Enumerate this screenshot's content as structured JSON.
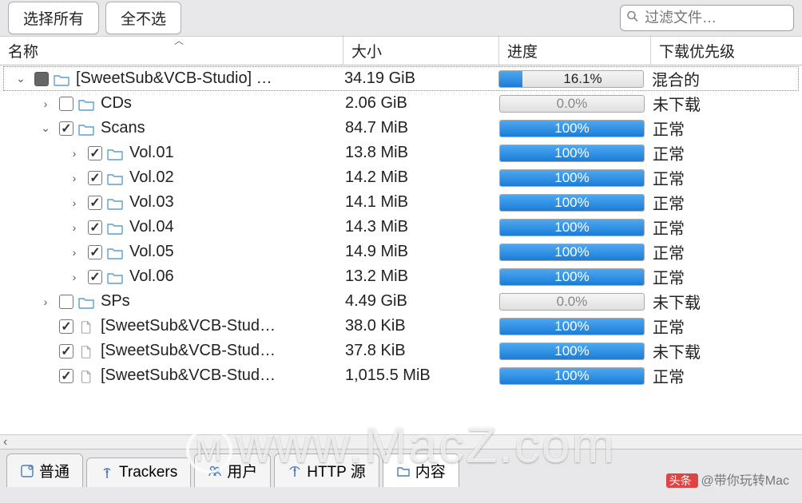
{
  "toolbar": {
    "selectAll": "选择所有",
    "selectNone": "全不选",
    "filterPlaceholder": "过滤文件…"
  },
  "columns": {
    "name": "名称",
    "size": "大小",
    "progress": "进度",
    "priority": "下载优先级"
  },
  "rows": [
    {
      "depth": 0,
      "disclosure": "down",
      "check": "mixed",
      "icon": "folder",
      "name": "[SweetSub&VCB-Studio] …",
      "size": "34.19 GiB",
      "progress": 16.1,
      "progressText": "16.1%",
      "priority": "混合的"
    },
    {
      "depth": 1,
      "disclosure": "right",
      "check": "unchecked",
      "icon": "folder",
      "name": "CDs",
      "size": "2.06 GiB",
      "progress": 0,
      "progressText": "0.0%",
      "priority": "未下载"
    },
    {
      "depth": 1,
      "disclosure": "down",
      "check": "checked",
      "icon": "folder",
      "name": "Scans",
      "size": "84.7 MiB",
      "progress": 100,
      "progressText": "100%",
      "priority": "正常"
    },
    {
      "depth": 2,
      "disclosure": "right",
      "check": "checked",
      "icon": "folder",
      "name": "Vol.01",
      "size": "13.8 MiB",
      "progress": 100,
      "progressText": "100%",
      "priority": "正常"
    },
    {
      "depth": 2,
      "disclosure": "right",
      "check": "checked",
      "icon": "folder",
      "name": "Vol.02",
      "size": "14.2 MiB",
      "progress": 100,
      "progressText": "100%",
      "priority": "正常"
    },
    {
      "depth": 2,
      "disclosure": "right",
      "check": "checked",
      "icon": "folder",
      "name": "Vol.03",
      "size": "14.1 MiB",
      "progress": 100,
      "progressText": "100%",
      "priority": "正常"
    },
    {
      "depth": 2,
      "disclosure": "right",
      "check": "checked",
      "icon": "folder",
      "name": "Vol.04",
      "size": "14.3 MiB",
      "progress": 100,
      "progressText": "100%",
      "priority": "正常"
    },
    {
      "depth": 2,
      "disclosure": "right",
      "check": "checked",
      "icon": "folder",
      "name": "Vol.05",
      "size": "14.9 MiB",
      "progress": 100,
      "progressText": "100%",
      "priority": "正常"
    },
    {
      "depth": 2,
      "disclosure": "right",
      "check": "checked",
      "icon": "folder",
      "name": "Vol.06",
      "size": "13.2 MiB",
      "progress": 100,
      "progressText": "100%",
      "priority": "正常"
    },
    {
      "depth": 1,
      "disclosure": "right",
      "check": "unchecked",
      "icon": "folder",
      "name": "SPs",
      "size": "4.49 GiB",
      "progress": 0,
      "progressText": "0.0%",
      "priority": "未下载"
    },
    {
      "depth": 1,
      "disclosure": "none",
      "check": "checked",
      "icon": "file",
      "name": "[SweetSub&VCB-Stud…",
      "size": "38.0 KiB",
      "progress": 100,
      "progressText": "100%",
      "priority": "正常"
    },
    {
      "depth": 1,
      "disclosure": "none",
      "check": "checked",
      "icon": "file",
      "name": "[SweetSub&VCB-Stud…",
      "size": "37.8 KiB",
      "progress": 100,
      "progressText": "100%",
      "priority": "未下载"
    },
    {
      "depth": 1,
      "disclosure": "none",
      "check": "checked",
      "icon": "file",
      "name": "[SweetSub&VCB-Stud…",
      "size": "1,015.5 MiB",
      "progress": 100,
      "progressText": "100%",
      "priority": "正常"
    }
  ],
  "tabs": [
    {
      "id": "general",
      "label": "普通",
      "icon": "info"
    },
    {
      "id": "trackers",
      "label": "Trackers",
      "icon": "antenna"
    },
    {
      "id": "peers",
      "label": "用户",
      "icon": "peers"
    },
    {
      "id": "http",
      "label": "HTTP 源",
      "icon": "http"
    },
    {
      "id": "content",
      "label": "内容",
      "icon": "folder",
      "active": true
    }
  ],
  "watermark": "www.MacZ.com",
  "byline": "@带你玩转Mac"
}
